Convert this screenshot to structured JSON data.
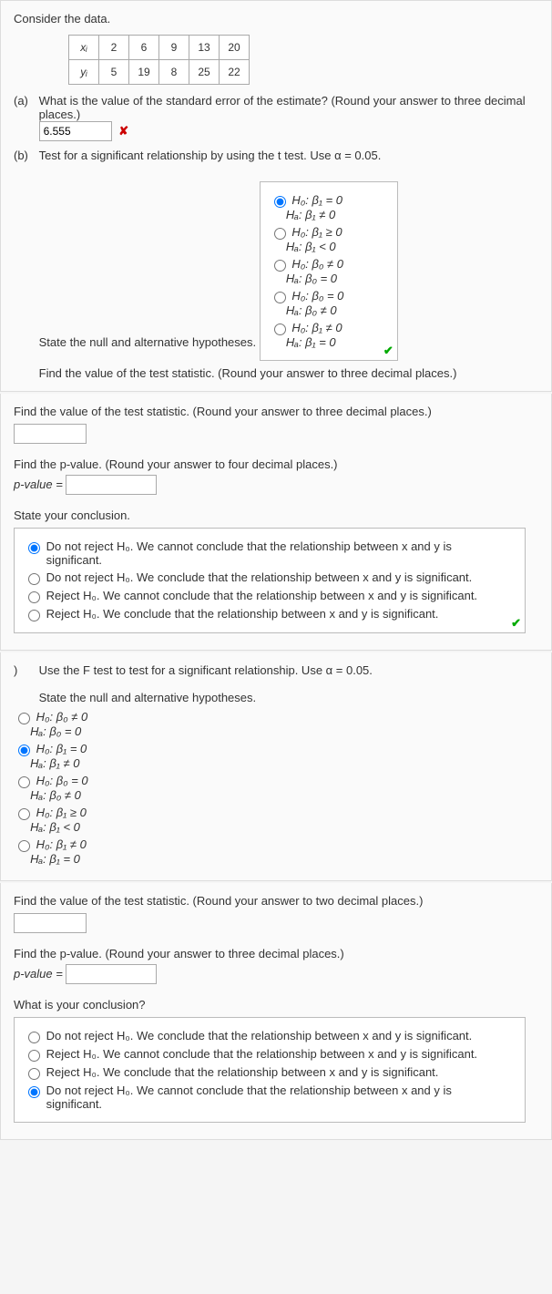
{
  "intro": "Consider the data.",
  "table": {
    "xi": "xᵢ",
    "yi": "yᵢ",
    "x": [
      "2",
      "6",
      "9",
      "13",
      "20"
    ],
    "y": [
      "5",
      "19",
      "8",
      "25",
      "22"
    ]
  },
  "a": {
    "label": "(a)",
    "question": "What is the value of the standard error of the estimate? (Round your answer to three decimal places.)",
    "input": "6.555",
    "wrong_icon": "✘"
  },
  "b": {
    "label": "(b)",
    "question": "Test for a significant relationship by using the t test. Use α = 0.05.",
    "state_hyp": "State the null and alternative hypotheses.",
    "opts": [
      {
        "h0": "H₀: β₁ = 0",
        "ha": "Hₐ: β₁ ≠ 0",
        "sel": true
      },
      {
        "h0": "H₀: β₁ ≥ 0",
        "ha": "Hₐ: β₁ < 0",
        "sel": false
      },
      {
        "h0": "H₀: β₀ ≠ 0",
        "ha": "Hₐ: β₀ = 0",
        "sel": false
      },
      {
        "h0": "H₀: β₀ = 0",
        "ha": "Hₐ: β₀ ≠ 0",
        "sel": false
      },
      {
        "h0": "H₀: β₁ ≠ 0",
        "ha": "Hₐ: β₁ = 0",
        "sel": false
      }
    ],
    "check_icon": "✔",
    "find_ts": "Find the value of the test statistic. (Round your answer to three decimal places.)"
  },
  "ts2": {
    "find_ts": "Find the value of the test statistic. (Round your answer to three decimal places.)",
    "find_p": "Find the p-value. (Round your answer to four decimal places.)",
    "pvalue_label": "p-value =",
    "state_conc": "State your conclusion.",
    "conc_opts": [
      {
        "txt": "Do not reject H₀. We cannot conclude that the relationship between x and y is significant.",
        "sel": true
      },
      {
        "txt": "Do not reject H₀. We conclude that the relationship between x and y is significant.",
        "sel": false
      },
      {
        "txt": "Reject H₀. We cannot conclude that the relationship between x and y is significant.",
        "sel": false
      },
      {
        "txt": "Reject H₀. We conclude that the relationship between x and y is significant.",
        "sel": false
      }
    ],
    "check_icon": "✔"
  },
  "c": {
    "label": ")",
    "question": "Use the F test to test for a significant relationship. Use α = 0.05.",
    "state_hyp": "State the null and alternative hypotheses.",
    "opts": [
      {
        "h0": "H₀: β₀ ≠ 0",
        "ha": "Hₐ: β₀ = 0",
        "sel": false
      },
      {
        "h0": "H₀: β₁ = 0",
        "ha": "Hₐ: β₁ ≠ 0",
        "sel": true
      },
      {
        "h0": "H₀: β₀ = 0",
        "ha": "Hₐ: β₀ ≠ 0",
        "sel": false
      },
      {
        "h0": "H₀: β₁ ≥ 0",
        "ha": "Hₐ: β₁ < 0",
        "sel": false
      },
      {
        "h0": "H₀: β₁ ≠ 0",
        "ha": "Hₐ: β₁ = 0",
        "sel": false
      }
    ]
  },
  "c2": {
    "find_ts": "Find the value of the test statistic. (Round your answer to two decimal places.)",
    "find_p": "Find the p-value. (Round your answer to three decimal places.)",
    "pvalue_label": "p-value =",
    "what_conc": "What is your conclusion?",
    "conc_opts": [
      {
        "txt": "Do not reject H₀. We conclude that the relationship between x and y is significant.",
        "sel": false
      },
      {
        "txt": "Reject H₀. We cannot conclude that the relationship between x and y is significant.",
        "sel": false
      },
      {
        "txt": "Reject H₀. We conclude that the relationship between x and y is significant.",
        "sel": false
      },
      {
        "txt": "Do not reject H₀. We cannot conclude that the relationship between x and y is significant.",
        "sel": true
      }
    ]
  },
  "chart_data": {
    "type": "table",
    "title": "Regression data (xi, yi) pairs",
    "columns": [
      "xi",
      "yi"
    ],
    "rows": [
      [
        2,
        5
      ],
      [
        6,
        19
      ],
      [
        9,
        8
      ],
      [
        13,
        25
      ],
      [
        20,
        22
      ]
    ]
  }
}
